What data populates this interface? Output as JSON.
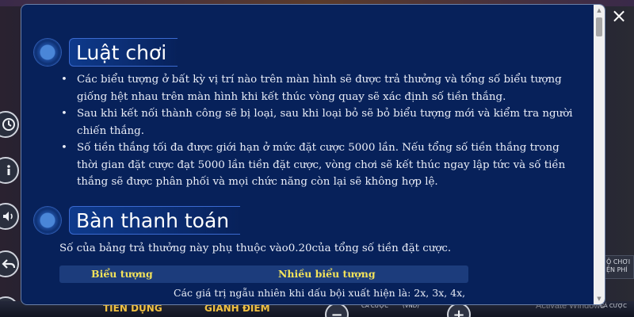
{
  "background": {
    "bottom_left_label": "TIỀN DỤNG",
    "bottom_mid_label": "GIÀNH ĐIỂM",
    "bottom_bet_label": "CÁ CƯỢC",
    "bottom_bet_sub": "(VND)",
    "right_button_label": "Ộ CHƠI\nỆN PHÍ",
    "bottom_right_label": "CÁ CƯỢC",
    "watermark": "Activate Windows",
    "minus_symbol": "−",
    "plus_symbol": "+"
  },
  "modal": {
    "close_symbol": "×",
    "sections": [
      {
        "title": "Luật chơi"
      },
      {
        "title": "Bàn thanh toán"
      }
    ],
    "rules": [
      "Các biểu tượng ở bất kỳ vị trí nào trên màn hình sẽ được trả thưởng và tổng số biểu tượng giống hệt nhau trên màn hình khi kết thúc vòng quay sẽ xác định số tiền thắng.",
      "Sau khi kết nối thành công sẽ bị loại, sau khi loại bỏ sẽ bỏ biểu tượng mới và kiểm tra người chiến thắng.",
      "Số tiền thắng tối đa được giới hạn ở mức đặt cược 5000 lần. Nếu tổng số tiền thắng trong thời gian đặt cược đạt 5000 lần tiền đặt cược, vòng chơi sẽ kết thúc ngay lập tức và số tiền thắng sẽ được phân phối và mọi chức năng còn lại sẽ không hợp lệ."
    ],
    "paytable": {
      "description": "Số của bảng trả thưởng này phụ thuộc vào0.20của tổng số tiền đặt cược.",
      "columns": [
        "Biểu tượng",
        "Nhiều biểu tượng"
      ],
      "random_values_text": "Các giá trị ngẫu nhiên khi dấu bội xuất hiện là: 2x, 3x, 4x,"
    }
  }
}
